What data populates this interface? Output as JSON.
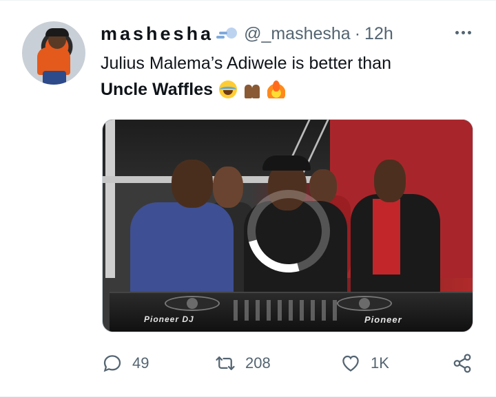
{
  "tweet": {
    "display_name": "mashesha",
    "name_emoji": "dash-emoji",
    "handle": "@_mashesha",
    "separator": "·",
    "time": "12h",
    "text_line1": "Julius Malema’s Adiwele is better than",
    "text_bold": "Uncle Waffles",
    "emojis": [
      "face-with-tears-of-joy",
      "raising-hands",
      "fire"
    ],
    "media": {
      "type": "video",
      "state": "loading",
      "brand_left": "Pioneer DJ",
      "brand_right": "Pioneer"
    }
  },
  "actions": {
    "reply_count": "49",
    "retweet_count": "208",
    "like_count": "1K"
  },
  "colors": {
    "text": "#0f1419",
    "secondary": "#536471",
    "border": "#cfd9de"
  }
}
